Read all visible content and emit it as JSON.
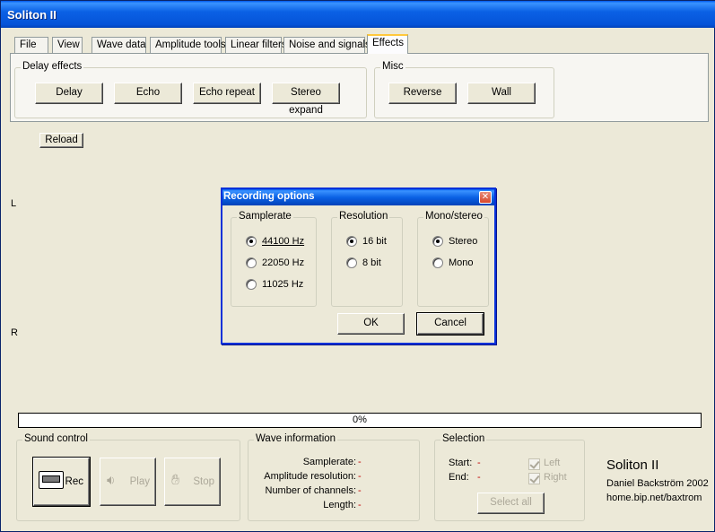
{
  "window": {
    "title": "Soliton II"
  },
  "tabs": [
    "File",
    "View",
    "Wave data",
    "Amplitude tools",
    "Linear filters",
    "Noise and signals",
    "Effects"
  ],
  "active_tab": "Effects",
  "effects": {
    "delay_group": {
      "label": "Delay effects",
      "buttons": [
        "Delay",
        "Echo",
        "Echo repeat",
        "Stereo expand"
      ]
    },
    "misc_group": {
      "label": "Misc",
      "buttons": [
        "Reverse",
        "Wall"
      ]
    }
  },
  "reload_label": "Reload",
  "channels": {
    "left": "L",
    "right": "R"
  },
  "dialog": {
    "title": "Recording options",
    "samplerate": {
      "label": "Samplerate",
      "options": [
        "44100 Hz",
        "22050 Hz",
        "11025 Hz"
      ],
      "selected": "44100 Hz"
    },
    "resolution": {
      "label": "Resolution",
      "options": [
        "16 bit",
        "8 bit"
      ],
      "selected": "16 bit"
    },
    "mono_stereo": {
      "label": "Mono/stereo",
      "options": [
        "Stereo",
        "Mono"
      ],
      "selected": "Stereo"
    },
    "ok_label": "OK",
    "cancel_label": "Cancel"
  },
  "progress": {
    "text": "0%",
    "value": 0
  },
  "sound_control": {
    "label": "Sound control",
    "rec": "Rec",
    "play": "Play",
    "stop": "Stop"
  },
  "wave_info": {
    "label": "Wave information",
    "rows": [
      {
        "key": "Samplerate:",
        "value": "-"
      },
      {
        "key": "Amplitude resolution:",
        "value": "-"
      },
      {
        "key": "Number of channels:",
        "value": "-"
      },
      {
        "key": "Length:",
        "value": "-"
      }
    ]
  },
  "selection": {
    "label": "Selection",
    "start_label": "Start:",
    "start_value": "-",
    "end_label": "End:",
    "end_value": "-",
    "left_label": "Left",
    "right_label": "Right",
    "select_all": "Select all"
  },
  "about": {
    "name": "Soliton II",
    "author": "Daniel Backström 2002",
    "url": "home.bip.net/baxtrom"
  },
  "colors": {
    "titlebar": "#0553d8",
    "window_bg": "#ece9d8",
    "accent_value": "#c00000"
  }
}
